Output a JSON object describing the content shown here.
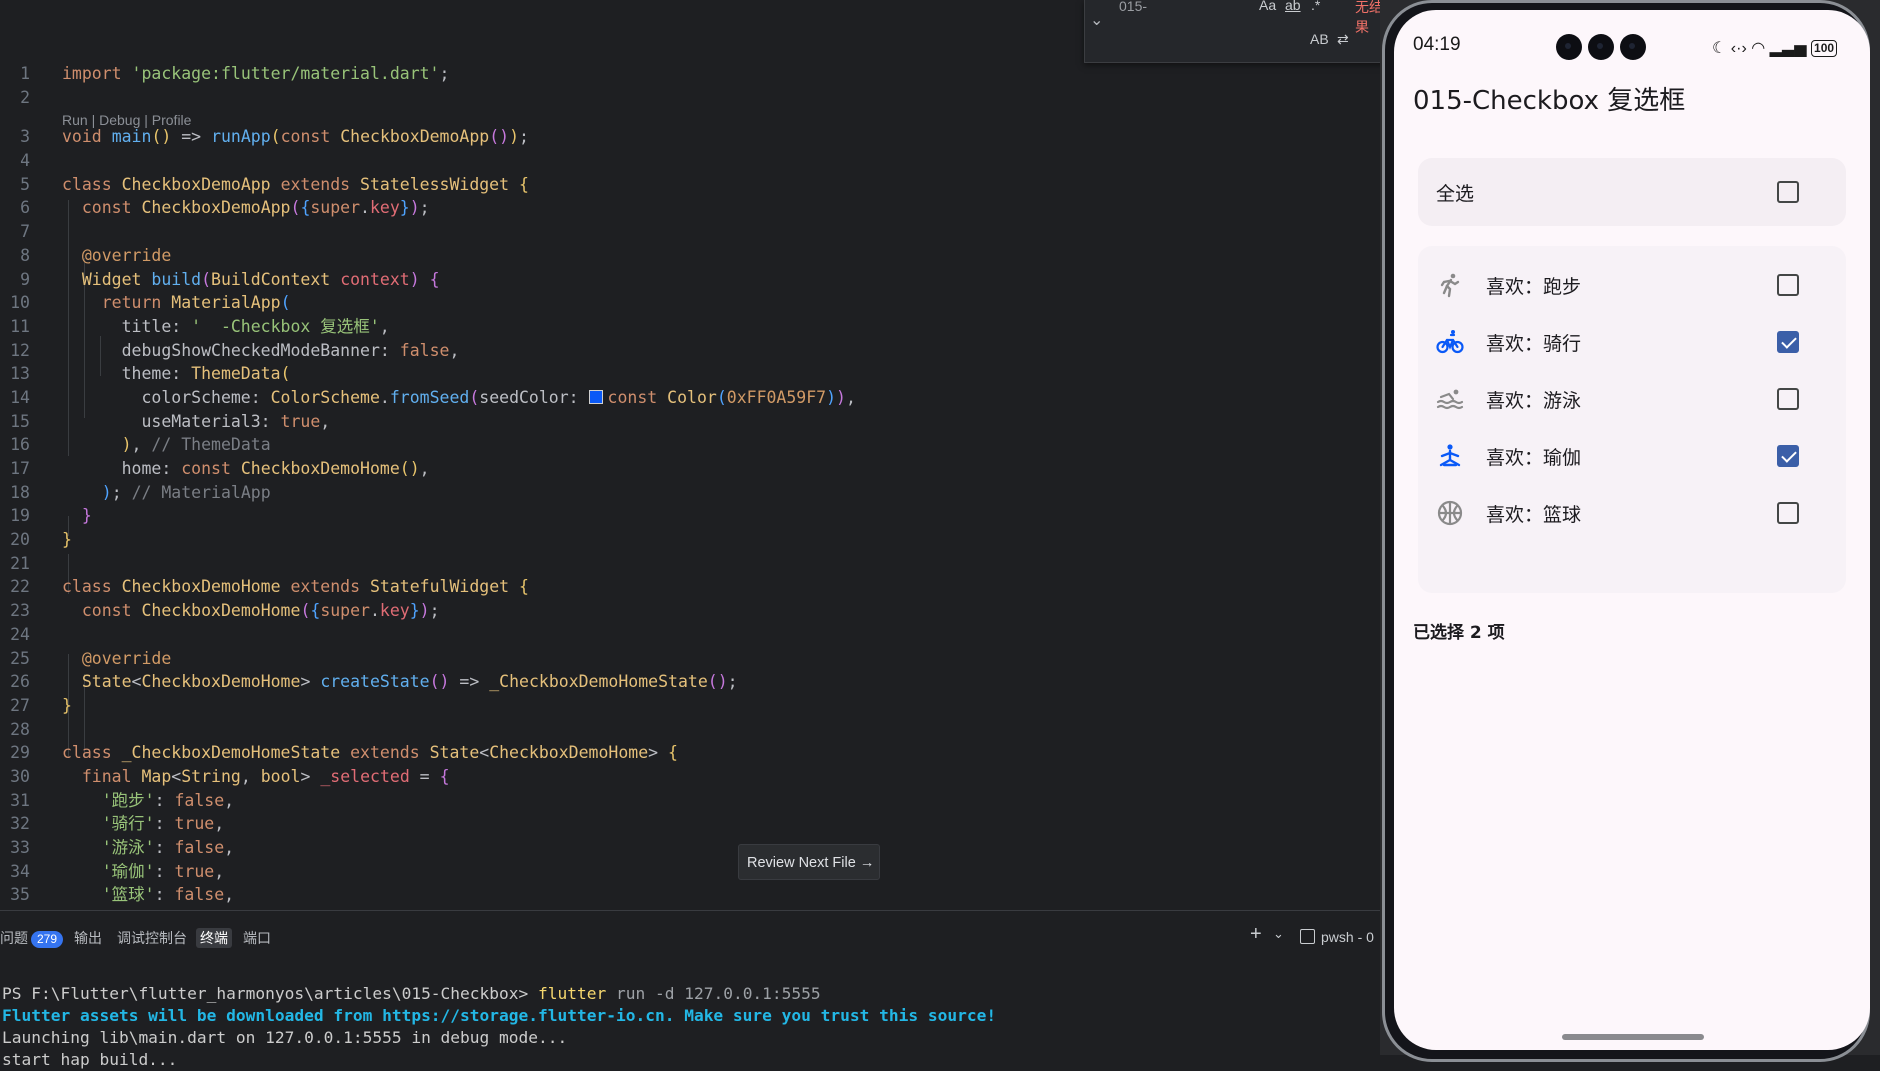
{
  "find": {
    "query": "015-",
    "no_results": "无结果",
    "match_case": "Aa",
    "whole_word": "ab",
    "regex": ".*",
    "preserve_case": "AB"
  },
  "codelens": "Run | Debug | Profile",
  "code": [
    {
      "n": "1"
    },
    {
      "n": "2"
    },
    {
      "n": "3"
    },
    {
      "n": "4"
    },
    {
      "n": "5"
    },
    {
      "n": "6"
    },
    {
      "n": "7"
    },
    {
      "n": "8"
    },
    {
      "n": "9"
    },
    {
      "n": "10"
    },
    {
      "n": "11"
    },
    {
      "n": "12"
    },
    {
      "n": "13"
    },
    {
      "n": "14"
    },
    {
      "n": "15"
    },
    {
      "n": "16"
    },
    {
      "n": "17"
    },
    {
      "n": "18"
    },
    {
      "n": "19"
    },
    {
      "n": "20"
    },
    {
      "n": "21"
    },
    {
      "n": "22"
    },
    {
      "n": "23"
    },
    {
      "n": "24"
    },
    {
      "n": "25"
    },
    {
      "n": "26"
    },
    {
      "n": "27"
    },
    {
      "n": "28"
    },
    {
      "n": "29"
    },
    {
      "n": "30"
    },
    {
      "n": "31"
    },
    {
      "n": "32"
    },
    {
      "n": "33"
    },
    {
      "n": "34"
    },
    {
      "n": "35"
    }
  ],
  "review_next": "Review Next File",
  "panel": {
    "tabs": [
      {
        "label": "问题",
        "badge": "279"
      },
      {
        "label": "输出"
      },
      {
        "label": "调试控制台"
      },
      {
        "label": "终端"
      },
      {
        "label": "端口"
      }
    ],
    "shell": "pwsh - 0"
  },
  "terminal": {
    "prompt": "PS F:\\Flutter\\flutter_harmonyos\\articles\\015-Checkbox> ",
    "cmd": "flutter",
    "args": " run -d 127.0.0.1:5555",
    "line2": "Flutter assets will be downloaded from https://storage.flutter-io.cn. Make sure you trust this source!",
    "line3": "Launching lib\\main.dart on 127.0.0.1:5555 in debug mode...",
    "line4": "start hap build..."
  },
  "phone": {
    "time": "04:19",
    "battery": "100",
    "title": "015-Checkbox 复选框",
    "select_all": "全选",
    "items": [
      {
        "label": "喜欢：跑步",
        "icon": "running-icon",
        "checked": false
      },
      {
        "label": "喜欢：骑行",
        "icon": "cycling-icon",
        "checked": true
      },
      {
        "label": "喜欢：游泳",
        "icon": "swimming-icon",
        "checked": false
      },
      {
        "label": "喜欢：瑜伽",
        "icon": "yoga-icon",
        "checked": true
      },
      {
        "label": "喜欢：篮球",
        "icon": "basketball-icon",
        "checked": false
      }
    ],
    "count": "已选择 2 项"
  }
}
